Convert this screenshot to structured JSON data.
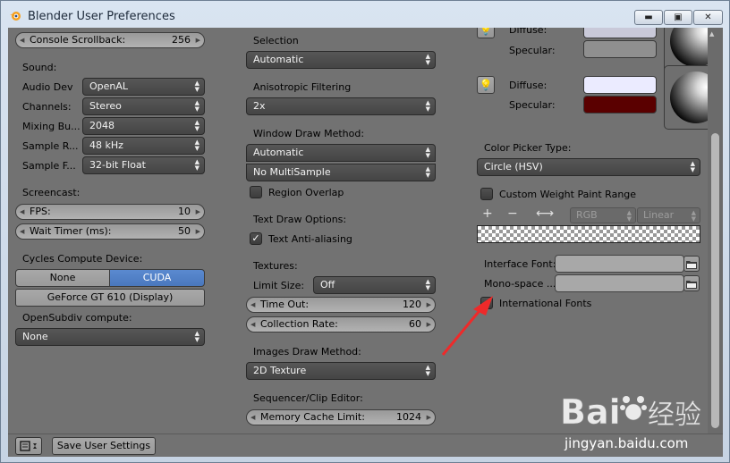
{
  "window": {
    "title": "Blender User Preferences",
    "minimize_icon": "minimize-icon",
    "maximize_icon": "maximize-icon",
    "close_icon": "close-icon"
  },
  "col1": {
    "console_scrollback": {
      "label": "Console Scrollback:",
      "value": "256"
    },
    "sound_header": "Sound:",
    "audio_dev": {
      "label": "Audio Dev",
      "value": "OpenAL"
    },
    "channels": {
      "label": "Channels:",
      "value": "Stereo"
    },
    "mixing_buffer": {
      "label": "Mixing Bu...",
      "value": "2048"
    },
    "sample_rate": {
      "label": "Sample R...",
      "value": "48 kHz"
    },
    "sample_format": {
      "label": "Sample F...",
      "value": "32-bit Float"
    },
    "screencast_header": "Screencast:",
    "fps": {
      "label": "FPS:",
      "value": "10"
    },
    "wait_timer": {
      "label": "Wait Timer (ms):",
      "value": "50"
    },
    "cycles_header": "Cycles Compute Device:",
    "device_none": "None",
    "device_cuda": "CUDA",
    "gpu_button": "GeForce GT 610 (Display)",
    "opensubdiv_header": "OpenSubdiv compute:",
    "opensubdiv_value": "None"
  },
  "col2": {
    "selection_header": "Selection",
    "selection_value": "Automatic",
    "aniso_header": "Anisotropic Filtering",
    "aniso_value": "2x",
    "window_draw_header": "Window Draw Method:",
    "window_draw_value": "Automatic",
    "multisample_value": "No MultiSample",
    "region_overlap": "Region Overlap",
    "text_draw_header": "Text Draw Options:",
    "text_antialiasing": "Text Anti-aliasing",
    "textures_header": "Textures:",
    "limit_size_label": "Limit Size:",
    "limit_size_value": "Off",
    "time_out": {
      "label": "Time Out:",
      "value": "120"
    },
    "collection_rate": {
      "label": "Collection Rate:",
      "value": "60"
    },
    "images_draw_header": "Images Draw Method:",
    "images_draw_value": "2D Texture",
    "sequencer_header": "Sequencer/Clip Editor:",
    "memory_cache": {
      "label": "Memory Cache Limit:",
      "value": "1024"
    }
  },
  "col3": {
    "diffuse1": "Diffuse:",
    "specular1": "Specular:",
    "diffuse2": "Diffuse:",
    "specular2": "Specular:",
    "color_picker_header": "Color Picker Type:",
    "color_picker_value": "Circle (HSV)",
    "custom_weight": "Custom Weight Paint Range",
    "mode_rgb": "RGB",
    "mode_linear": "Linear",
    "interface_font": "Interface Font:",
    "mono_font": "Mono-space ...",
    "international_fonts": "International Fonts",
    "colors": {
      "diffuse1": "#c9c9d9",
      "specular1": "#8f8f8f",
      "diffuse2": "#ebebff",
      "specular2": "#5a0000"
    }
  },
  "footer": {
    "save_label": "Save User Settings"
  },
  "watermark": {
    "text": "jingyan.baidu.com"
  }
}
